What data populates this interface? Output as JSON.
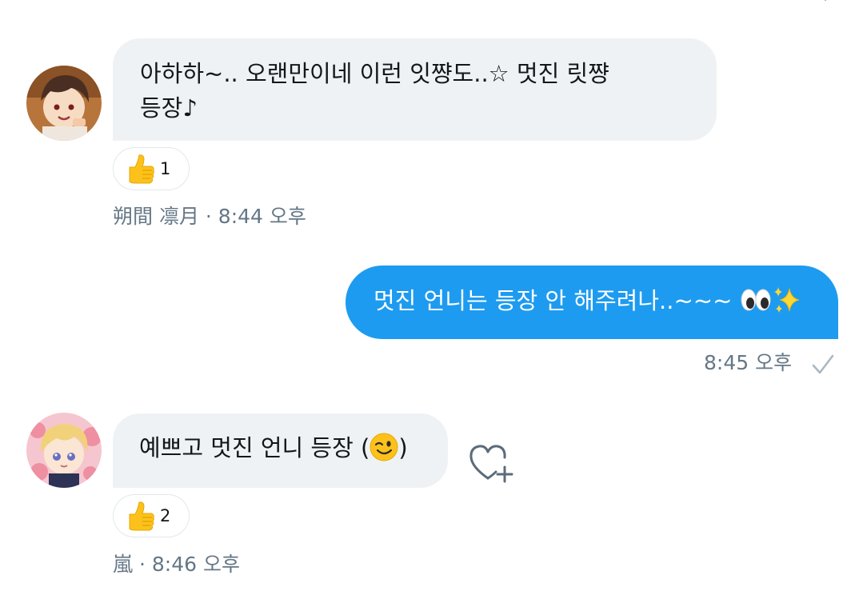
{
  "colors": {
    "incoming_bubble": "#eff2f4",
    "outgoing_bubble": "#1d9bf0",
    "meta_text": "#657786",
    "reaction_border": "#e1e8ed"
  },
  "messages": [
    {
      "direction": "incoming",
      "avatar_icon": "avatar-brown-hair-icon",
      "text_line1": "아하하~.. 오랜만이네 이런 잇쨩도..☆ 멋진 릿쨩",
      "text_line2": "등장♪",
      "reaction": {
        "icon": "thumbs-up-icon",
        "count": "1"
      },
      "sender": "朔間 凛月",
      "time": "8:44 오후"
    },
    {
      "direction": "outgoing",
      "text": "멋진 언니는 등장 안 해주려나..~~~ ",
      "emojis": [
        "eyes-icon",
        "sparkles-icon"
      ],
      "time": "8:45 오후",
      "status_icon": "check-icon"
    },
    {
      "direction": "incoming",
      "avatar_icon": "avatar-blonde-hair-icon",
      "text_before": "예쁘고 멋진 언니 등장 (",
      "emoji": "winking-face-icon",
      "text_after": ")",
      "reaction": {
        "icon": "thumbs-up-icon",
        "count": "2"
      },
      "sender": "嵐",
      "time": "8:46 오후",
      "action_icon": "heart-add-icon"
    }
  ],
  "meta_separator": " · "
}
